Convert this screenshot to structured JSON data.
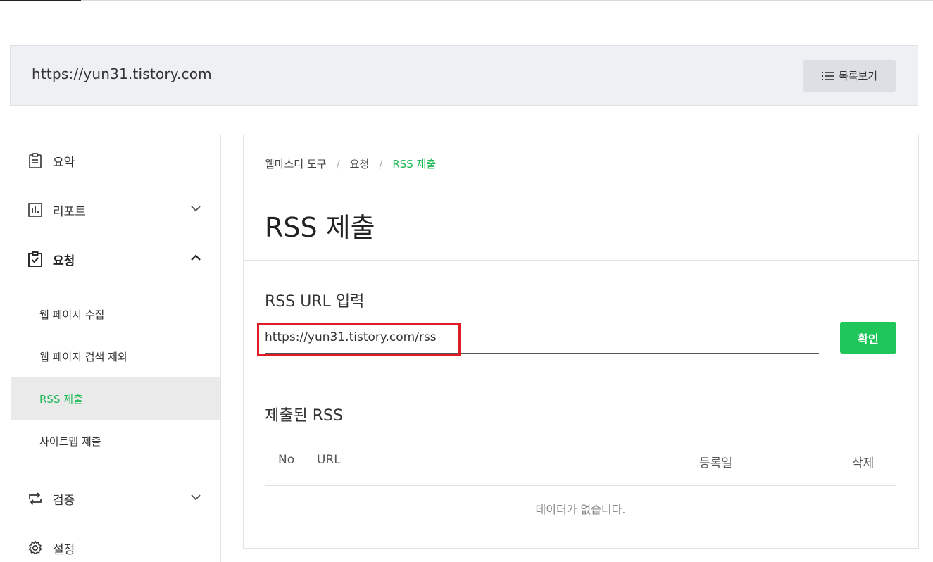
{
  "site": {
    "url": "https://yun31.tistory.com",
    "list_button": "목록보기"
  },
  "sidebar": {
    "items": [
      {
        "label": "요약",
        "icon": "clipboard-icon"
      },
      {
        "label": "리포트",
        "icon": "bar-chart-icon"
      },
      {
        "label": "요청",
        "icon": "checklist-icon"
      },
      {
        "label": "검증",
        "icon": "repeat-icon"
      },
      {
        "label": "설정",
        "icon": "gear-icon"
      }
    ],
    "sub_items": [
      {
        "label": "웹 페이지 수집"
      },
      {
        "label": "웹 페이지 검색 제외"
      },
      {
        "label": "RSS 제출"
      },
      {
        "label": "사이트맵 제출"
      }
    ]
  },
  "breadcrumb": [
    "웹마스터 도구",
    "요청",
    "RSS 제출"
  ],
  "page": {
    "title": "RSS 제출",
    "input_section_label": "RSS URL 입력",
    "rss_input_value": "https://yun31.tistory.com/rss",
    "confirm_button": "확인",
    "submitted_section_label": "제출된 RSS"
  },
  "table": {
    "columns": [
      "No",
      "URL",
      "등록일",
      "삭제"
    ],
    "empty_message": "데이터가 없습니다."
  },
  "colors": {
    "accent_green": "#1db954",
    "button_green": "#1fc75a",
    "highlight_red": "#e01b24"
  }
}
